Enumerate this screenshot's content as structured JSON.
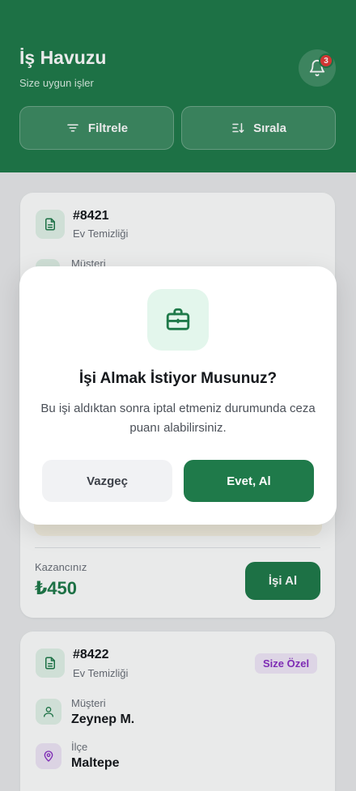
{
  "header": {
    "title": "İş Havuzu",
    "subtitle": "Size uygun işler",
    "notification_count": "3",
    "filter_label": "Filtrele",
    "sort_label": "Sırala"
  },
  "jobs": [
    {
      "number": "#8421",
      "type": "Ev Temizliği",
      "customer_label": "Müşteri",
      "earnings_label": "Kazancınız",
      "earnings": "₺450",
      "take_label": "İşi Al"
    },
    {
      "number": "#8422",
      "type": "Ev Temizliği",
      "tag": "Size Özel",
      "customer_label": "Müşteri",
      "customer": "Zeynep M.",
      "district_label": "İlçe",
      "district": "Maltepe"
    }
  ],
  "modal": {
    "title": "İşi Almak İstiyor Musunuz?",
    "message": "Bu işi aldıktan sonra iptal etmeniz durumunda ceza puanı alabilirsiniz.",
    "cancel_label": "Vazgeç",
    "confirm_label": "Evet, Al"
  },
  "colors": {
    "primary": "#1f7a4a",
    "badge": "#e53935",
    "tag_text": "#8a2fc4"
  },
  "icons": [
    "bell-icon",
    "filter-icon",
    "sort-icon",
    "document-icon",
    "user-icon",
    "location-pin-icon",
    "briefcase-icon"
  ]
}
